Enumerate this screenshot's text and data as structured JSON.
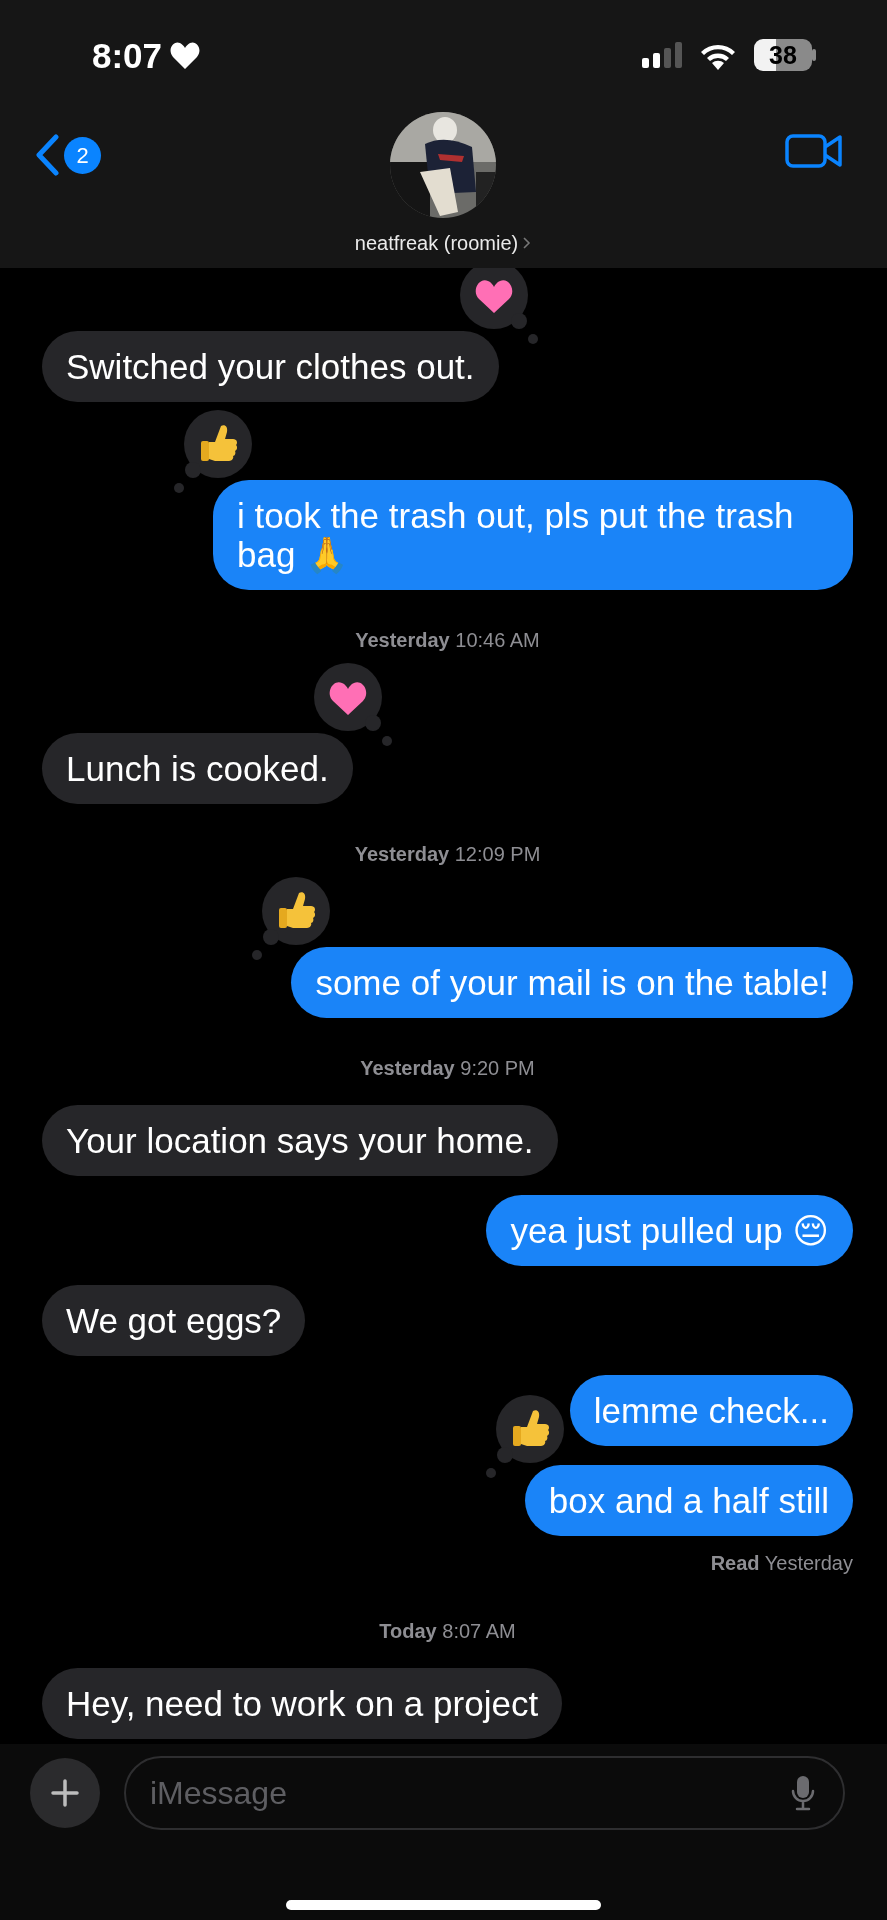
{
  "status_bar": {
    "time": "8:07",
    "battery": "38"
  },
  "header": {
    "back_badge": "2",
    "contact_name": "neatfreak (roomie)"
  },
  "messages": [
    {
      "kind": "message",
      "sent": false,
      "text": "Switched your clothes out.",
      "reaction": {
        "kind": "heart"
      }
    },
    {
      "kind": "message",
      "sent": true,
      "text": "i took the trash out, pls put the trash bag 🙏",
      "reaction": {
        "kind": "thumbs-up"
      }
    },
    {
      "kind": "timestamp",
      "text": "**Yesterday** 10:46 AM"
    },
    {
      "kind": "message",
      "sent": false,
      "text": "Lunch is cooked.",
      "reaction": {
        "kind": "heart"
      }
    },
    {
      "kind": "timestamp",
      "text": "**Yesterday** 12:09 PM"
    },
    {
      "kind": "message",
      "sent": true,
      "text": "some of your mail is on the table!",
      "reaction": {
        "kind": "thumbs-up"
      }
    },
    {
      "kind": "timestamp",
      "text": "**Yesterday** 9:20 PM"
    },
    {
      "kind": "message",
      "sent": false,
      "text": "Your location says your home."
    },
    {
      "kind": "message",
      "sent": true,
      "text": "yea just pulled up 😔"
    },
    {
      "kind": "message",
      "sent": false,
      "text": "We got eggs?"
    },
    {
      "kind": "message",
      "sent": true,
      "text": "lemme check..."
    },
    {
      "kind": "message",
      "sent": true,
      "text": "box and a half still",
      "reaction": {
        "kind": "thumbs-up"
      }
    },
    {
      "kind": "receipt",
      "text": "**Read** Yesterday"
    },
    {
      "kind": "timestamp",
      "text": "**Today** 8:07 AM"
    },
    {
      "kind": "message",
      "sent": false,
      "text": "Hey, need to work on a project"
    }
  ],
  "composer": {
    "placeholder": "iMessage"
  }
}
